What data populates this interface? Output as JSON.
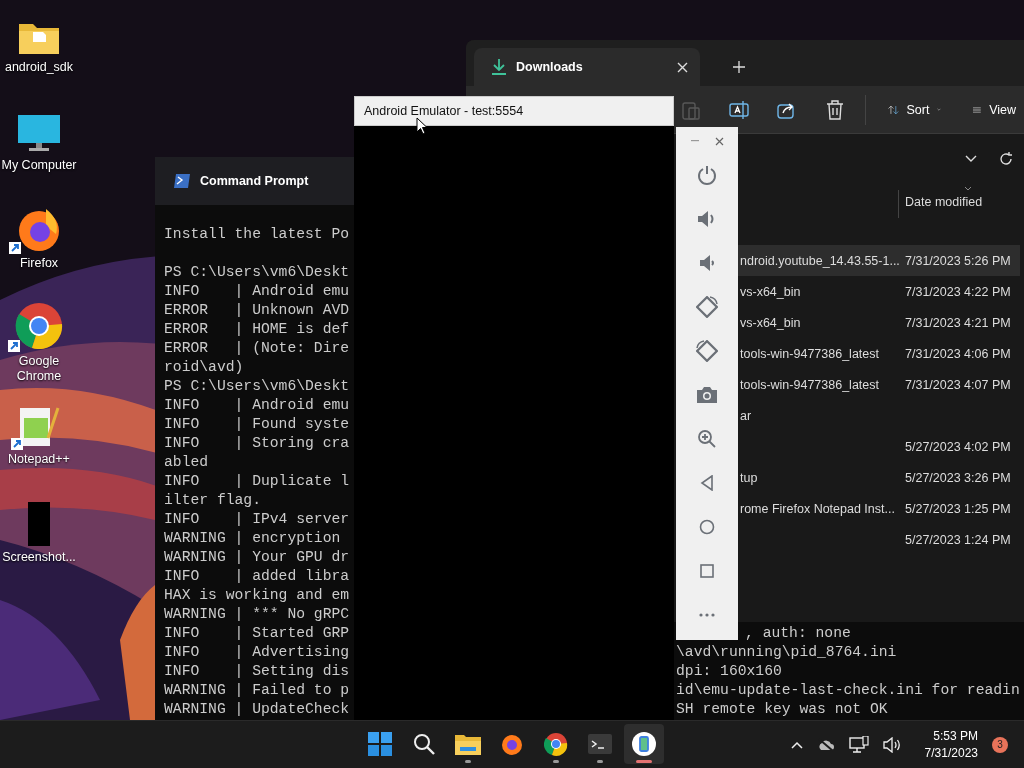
{
  "desktop_icons": [
    {
      "label": "android_sdk",
      "kind": "folder",
      "shortcut": false
    },
    {
      "label": "My Computer",
      "kind": "computer",
      "shortcut": false
    },
    {
      "label": "Firefox",
      "kind": "firefox",
      "shortcut": true
    },
    {
      "label": "Google Chrome",
      "kind": "chrome",
      "shortcut": true
    },
    {
      "label": "Notepad++",
      "kind": "notepad",
      "shortcut": true
    },
    {
      "label": "Screenshot...",
      "kind": "thumbnail",
      "shortcut": false
    }
  ],
  "terminal": {
    "title": "Command Prompt",
    "lines": [
      {
        "kind": "text",
        "left": "Install the latest Po"
      },
      {
        "kind": "blank"
      },
      {
        "kind": "text",
        "left": "PS C:\\Users\\vm6\\Deskt"
      },
      {
        "kind": "text",
        "left": "INFO    | Android emu"
      },
      {
        "kind": "text",
        "left": "ERROR   | Unknown AVD"
      },
      {
        "kind": "text",
        "left": "ERROR   | HOME is def"
      },
      {
        "kind": "text",
        "left": "ERROR   | (Note: Dire"
      },
      {
        "kind": "text",
        "left": "roid\\avd)"
      },
      {
        "kind": "text",
        "left": "PS C:\\Users\\vm6\\Deskt"
      },
      {
        "kind": "text",
        "left": "INFO    | Android emu"
      },
      {
        "kind": "text",
        "left": "INFO    | Found syste"
      },
      {
        "kind": "text",
        "left": "INFO    | Storing cra"
      },
      {
        "kind": "text",
        "left": "abled"
      },
      {
        "kind": "text",
        "left": "INFO    | Duplicate l"
      },
      {
        "kind": "text",
        "left": "ilter flag."
      },
      {
        "kind": "text",
        "left": "INFO    | IPv4 server"
      },
      {
        "kind": "text",
        "left": "WARNING | encryption"
      },
      {
        "kind": "text",
        "left": "WARNING | Your GPU dr"
      },
      {
        "kind": "text",
        "left": "INFO    | added libra"
      },
      {
        "kind": "text",
        "left": "HAX is working and em"
      },
      {
        "kind": "text",
        "left": "WARNING | *** No gRPC"
      },
      {
        "kind": "text",
        "left": "INFO    | Started GRP",
        "right": ", auth: none"
      },
      {
        "kind": "text",
        "left": "INFO    | Advertising",
        "right": "\\avd\\running\\pid_8764.ini"
      },
      {
        "kind": "text",
        "left": "INFO    | Setting dis",
        "right": "dpi: 160x160"
      },
      {
        "kind": "text",
        "left": "WARNING | Failed to p",
        "right": "id\\emu-update-last-check.ini for readin"
      },
      {
        "kind": "text",
        "left": "WARNING | UpdateCheck",
        "right": "SH remote key was not OK"
      }
    ]
  },
  "file_explorer": {
    "tabs": [
      {
        "label": "Downloads",
        "selected": true
      }
    ],
    "toolbar": [
      {
        "kind": "paste",
        "disabled": true
      },
      {
        "kind": "rename",
        "disabled": false
      },
      {
        "kind": "share",
        "disabled": false
      },
      {
        "kind": "delete",
        "disabled": false
      },
      {
        "kind": "sort",
        "label": "Sort",
        "disabled": false
      },
      {
        "kind": "view",
        "label": "View",
        "disabled": false
      }
    ],
    "columns": [
      "Date modified"
    ],
    "rows": [
      {
        "name": "ndroid.youtube_14.43.55-1...",
        "date": "7/31/2023 5:26 PM",
        "selected": true
      },
      {
        "name": "vs-x64_bin",
        "date": "7/31/2023 4:22 PM",
        "selected": false
      },
      {
        "name": "vs-x64_bin",
        "date": "7/31/2023 4:21 PM",
        "selected": false
      },
      {
        "name": "tools-win-9477386_latest",
        "date": "7/31/2023 4:06 PM",
        "selected": false
      },
      {
        "name": "tools-win-9477386_latest",
        "date": "7/31/2023 4:07 PM",
        "selected": false
      },
      {
        "name": "ar",
        "selected": false
      },
      {
        "date": "5/27/2023 4:02 PM",
        "selected": false
      },
      {
        "name": "tup",
        "date": "5/27/2023 3:26 PM",
        "selected": false
      },
      {
        "name": "rome Firefox Notepad Inst...",
        "date": "5/27/2023 1:25 PM",
        "selected": false
      },
      {
        "date": "5/27/2023 1:24 PM",
        "selected": false
      }
    ]
  },
  "emulator": {
    "title": "Android Emulator - test:5554",
    "controls": [
      {
        "kind": "power"
      },
      {
        "kind": "volume_up"
      },
      {
        "kind": "volume_down"
      },
      {
        "kind": "rotate_left"
      },
      {
        "kind": "rotate_right"
      },
      {
        "kind": "camera"
      },
      {
        "kind": "zoom"
      },
      {
        "kind": "back"
      },
      {
        "kind": "home"
      },
      {
        "kind": "overview"
      },
      {
        "kind": "more"
      }
    ]
  },
  "taskbar": {
    "apps": [
      {
        "kind": "start",
        "running": false,
        "selected": false
      },
      {
        "kind": "search",
        "running": false,
        "selected": false
      },
      {
        "kind": "explorer",
        "running": true,
        "selected": false
      },
      {
        "kind": "firefox",
        "running": false,
        "selected": false
      },
      {
        "kind": "chrome",
        "running": true,
        "selected": false
      },
      {
        "kind": "terminal",
        "running": true,
        "selected": false
      },
      {
        "kind": "emulator",
        "running": true,
        "selected": true
      }
    ],
    "tray": [
      {
        "kind": "chevron"
      },
      {
        "kind": "cloud_off"
      },
      {
        "kind": "network"
      },
      {
        "kind": "volume"
      }
    ],
    "time": "5:53 PM",
    "date": "7/31/2023",
    "notifications": "3"
  }
}
